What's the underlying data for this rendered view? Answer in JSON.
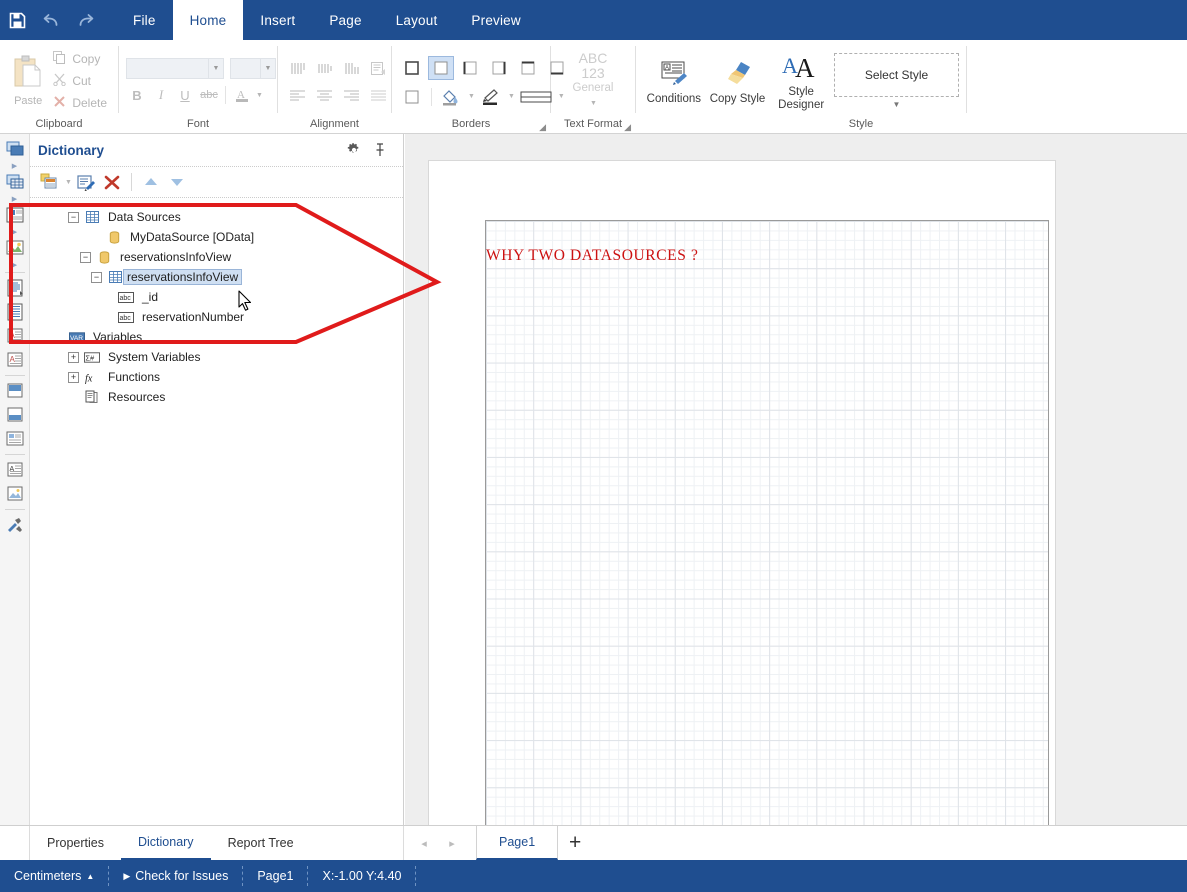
{
  "titlebar": {
    "icons": [
      {
        "name": "save-icon",
        "label": "Save"
      },
      {
        "name": "undo-icon",
        "label": "Undo"
      },
      {
        "name": "redo-icon",
        "label": "Redo"
      }
    ],
    "tabs": [
      {
        "label": "File",
        "active": false
      },
      {
        "label": "Home",
        "active": true
      },
      {
        "label": "Insert",
        "active": false
      },
      {
        "label": "Page",
        "active": false
      },
      {
        "label": "Layout",
        "active": false
      },
      {
        "label": "Preview",
        "active": false
      }
    ],
    "background": "#1f4e90"
  },
  "ribbon": {
    "clipboard": {
      "group_label": "Clipboard",
      "paste_label": "Paste",
      "commands": [
        {
          "label": "Copy",
          "icon": "copy-icon"
        },
        {
          "label": "Cut",
          "icon": "scissors-icon"
        },
        {
          "label": "Delete",
          "icon": "delete-x-icon"
        }
      ]
    },
    "font": {
      "group_label": "Font",
      "family_value": "",
      "size_value": "",
      "buttons": [
        {
          "label": "B",
          "name": "bold-button"
        },
        {
          "label": "I",
          "name": "italic-button"
        },
        {
          "label": "U",
          "name": "underline-button"
        },
        {
          "label": "abc",
          "name": "strikethrough-button"
        },
        {
          "label": "A",
          "name": "font-color-button"
        }
      ]
    },
    "alignment": {
      "group_label": "Alignment",
      "buttons": [
        "align-top-button",
        "align-middle-button",
        "align-bottom-button",
        "text-options-button",
        "align-left-button",
        "align-center-button",
        "align-right-button",
        "align-justify-button"
      ]
    },
    "borders": {
      "group_label": "Borders",
      "buttons": [
        "border-all-button",
        "border-none-button",
        "border-left-button",
        "border-right-button",
        "border-top-button",
        "border-bottom-button",
        "border-box-button",
        "fill-color-button",
        "border-color-button",
        "border-style-button"
      ],
      "selected_index": 1
    },
    "text_format": {
      "group_label": "Text Format",
      "line1": "ABC",
      "line2": "123",
      "line3": "General"
    },
    "style": {
      "group_label": "Style",
      "commands": [
        {
          "label": "Conditions",
          "icon": "conditions-icon"
        },
        {
          "label": "Copy Style",
          "icon": "paintbrush-icon"
        },
        {
          "label": "Style\nDesigner",
          "icon": "style-designer-icon"
        }
      ],
      "select_style_label": "Select Style"
    }
  },
  "toolstrip": {
    "items": [
      {
        "name": "tool-band",
        "has_arrow": true
      },
      {
        "name": "tool-data-band",
        "has_arrow": true
      },
      {
        "name": "tool-group-header",
        "has_arrow": true
      },
      {
        "name": "tool-image-band",
        "has_arrow": true
      },
      {
        "name": "tool-page-header",
        "has_arrow": false
      },
      {
        "name": "tool-page-footer",
        "has_arrow": false
      },
      {
        "name": "tool-text-a",
        "has_arrow": false
      },
      {
        "name": "tool-text-b",
        "has_arrow": false
      },
      {
        "name": "tool-panel-top",
        "has_arrow": false
      },
      {
        "name": "tool-panel-bottom",
        "has_arrow": false
      },
      {
        "name": "tool-table",
        "has_arrow": false
      },
      {
        "name": "tool-rich-text",
        "has_arrow": false
      },
      {
        "name": "tool-image",
        "has_arrow": false
      },
      {
        "name": "tool-settings",
        "has_arrow": false
      }
    ]
  },
  "dictionary": {
    "title": "Dictionary",
    "header_buttons": [
      {
        "name": "gear-icon",
        "label": "Settings"
      },
      {
        "name": "pin-icon",
        "label": "Pin"
      }
    ],
    "toolbar_buttons": [
      {
        "name": "new-item-icon",
        "label": "New Item"
      },
      {
        "name": "edit-icon",
        "label": "Edit"
      },
      {
        "name": "delete-x-icon",
        "label": "Delete"
      },
      {
        "name": "move-up-icon",
        "label": "Move Up"
      },
      {
        "name": "move-down-icon",
        "label": "Move Down"
      }
    ],
    "tree": [
      {
        "label": "Data Sources",
        "indent": 0,
        "expander": "minus",
        "icon": "table-icon",
        "selected": false
      },
      {
        "label": "MyDataSource [OData]",
        "indent": 1,
        "expander": "none",
        "icon": "datasource-icon",
        "selected": false
      },
      {
        "label": "reservationsInfoView",
        "indent": 1,
        "expander": "minus",
        "icon": "datasource-icon",
        "selected": false
      },
      {
        "label": "reservationsInfoView",
        "indent": 2,
        "expander": "minus",
        "icon": "table-icon",
        "selected": true
      },
      {
        "label": "_id",
        "indent": 3,
        "expander": "none",
        "icon": "abc-icon",
        "selected": false
      },
      {
        "label": "reservationNumber",
        "indent": 3,
        "expander": "none",
        "icon": "abc-icon",
        "selected": false
      },
      {
        "label": "Variables",
        "indent": 0,
        "expander": "none",
        "icon": "var-icon",
        "selected": false
      },
      {
        "label": "System Variables",
        "indent": 0,
        "expander": "plus",
        "icon": "sysvar-icon",
        "selected": false
      },
      {
        "label": "Functions",
        "indent": 0,
        "expander": "plus",
        "icon": "fx-icon",
        "selected": false
      },
      {
        "label": "Resources",
        "indent": 0,
        "expander": "none",
        "icon": "resources-icon",
        "selected": false
      }
    ]
  },
  "canvas": {
    "report_text": "WHY  TWO  DATASOURCES ?",
    "report_text_color": "#cc1111"
  },
  "annotation": {
    "color": "#e01b1b",
    "shape": "right-pointing-arrow-outline"
  },
  "bottom_tabs": {
    "left_tabs": [
      {
        "label": "Properties",
        "active": false
      },
      {
        "label": "Dictionary",
        "active": true
      },
      {
        "label": "Report Tree",
        "active": false
      }
    ],
    "nav_prev": "◂",
    "nav_next": "▸",
    "page_tab": "Page1",
    "add_page_label": "+"
  },
  "statusbar": {
    "units": "Centimeters",
    "units_arrow": "▲",
    "check_issues_arrow": "▶",
    "check_issues": "Check for Issues",
    "page": "Page1",
    "coordinates": "X:-1.00 Y:4.40",
    "background": "#1f4e90"
  }
}
